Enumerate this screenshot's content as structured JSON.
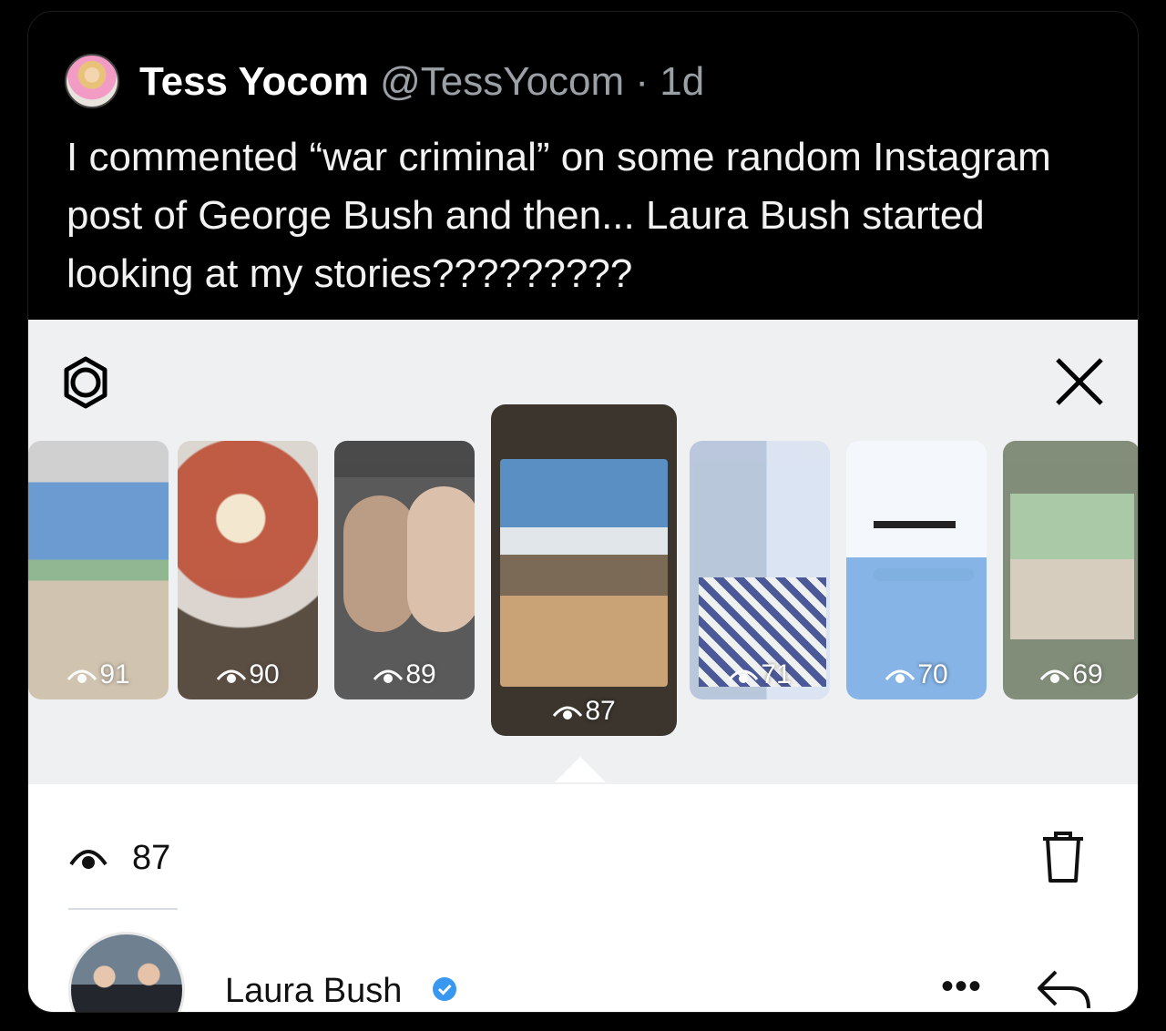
{
  "tweet": {
    "author_name": "Tess Yocom",
    "handle_meta": "@TessYocom · 1d",
    "text": "I commented “war criminal” on some random Instagram post of George Bush and then... Laura Bush started looking at my stories?????????"
  },
  "story_viewer": {
    "thumbnails": [
      {
        "views": "91"
      },
      {
        "views": "90"
      },
      {
        "views": "89"
      },
      {
        "views": "87",
        "selected": true
      },
      {
        "views": "71"
      },
      {
        "views": "70"
      },
      {
        "views": "69"
      }
    ],
    "view_count": "87",
    "viewer": {
      "name": "Laura Bush",
      "verified": true
    },
    "icons": [
      "settings-icon",
      "close-icon",
      "eye-icon",
      "trash-icon",
      "verified-icon",
      "more-icon",
      "reply-icon"
    ],
    "colors": {
      "panel_bg": "#eff0f2",
      "verified_blue": "#3897f0"
    }
  }
}
